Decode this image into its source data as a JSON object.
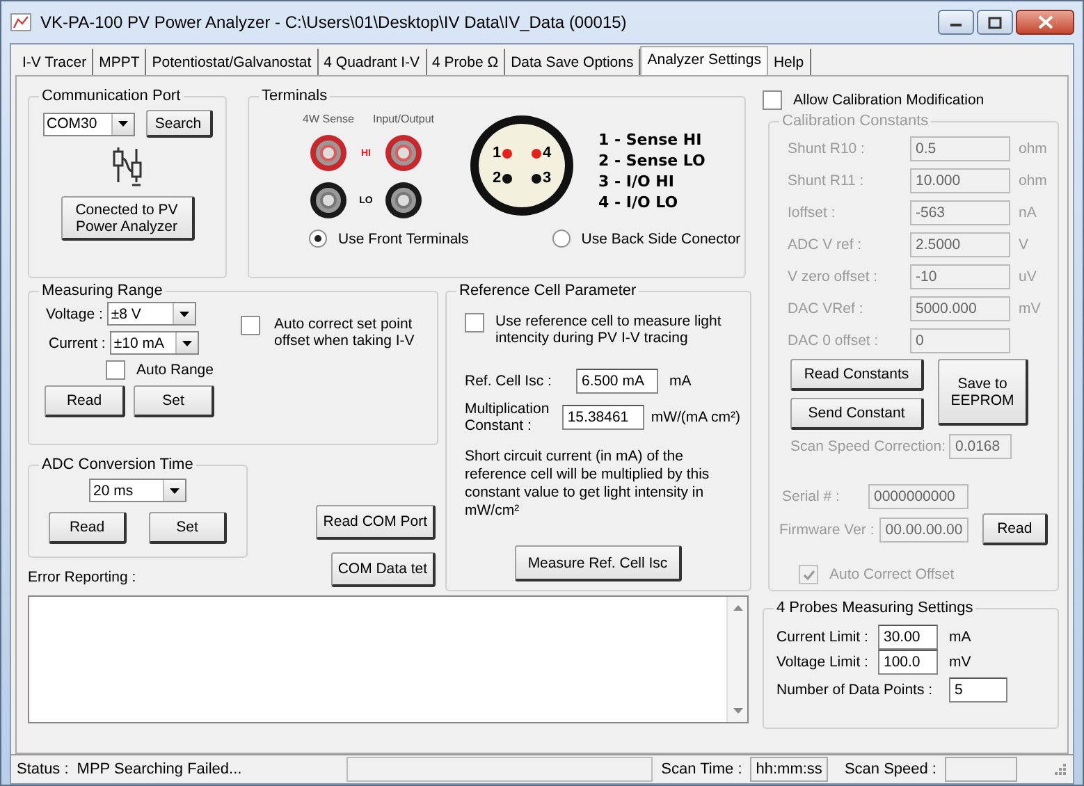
{
  "window": {
    "title": "VK-PA-100 PV Power Analyzer - C:\\Users\\01\\Desktop\\IV Data\\IV_Data (00015)"
  },
  "tabs": [
    {
      "label": "I-V Tracer",
      "selected": false
    },
    {
      "label": "MPPT",
      "selected": false
    },
    {
      "label": "Potentiostat/Galvanostat",
      "selected": false
    },
    {
      "label": "4 Quadrant I-V",
      "selected": false
    },
    {
      "label": "4 Probe Ω",
      "selected": false
    },
    {
      "label": "Data Save Options",
      "selected": false
    },
    {
      "label": "Analyzer Settings",
      "selected": true
    },
    {
      "label": "Help",
      "selected": false
    }
  ],
  "communication_port": {
    "title": "Communication Port",
    "port": "COM30",
    "search_button": "Search",
    "connect_button": "Conected to PV Power Analyzer"
  },
  "terminals": {
    "title": "Terminals",
    "front_labels": [
      "4W Sense",
      "Input/Output"
    ],
    "hi_label": "HI",
    "lo_label": "LO",
    "pins": [
      {
        "label": "1",
        "color": "#e8201c"
      },
      {
        "label": "4",
        "color": "#e8201c"
      },
      {
        "label": "2",
        "color": "#111111"
      },
      {
        "label": "3",
        "color": "#111111"
      }
    ],
    "legend": [
      "1 - Sense HI",
      "2 - Sense LO",
      "3 - I/O HI",
      "4 - I/O LO"
    ],
    "options": [
      {
        "label": "Use Front Terminals",
        "selected": true
      },
      {
        "label": "Use Back Side Conector",
        "selected": false
      }
    ]
  },
  "measuring_range": {
    "title": "Measuring Range",
    "voltage_label": "Voltage :",
    "voltage": "±8 V",
    "current_label": "Current :",
    "current": "±10 mA",
    "auto_range": {
      "label": "Auto Range",
      "checked": false
    },
    "buttons": [
      "Read",
      "Set"
    ],
    "auto_correct": {
      "label": "Auto correct set point offset when taking I-V",
      "checked": false
    }
  },
  "adc_conversion": {
    "title": "ADC Conversion Time",
    "value": "20 ms",
    "buttons": [
      "Read",
      "Set"
    ]
  },
  "com_buttons": [
    "Read COM Port",
    "COM Data tet"
  ],
  "reference_cell": {
    "title": "Reference Cell Parameter",
    "use_reference": {
      "label": "Use reference cell to measure light intencity during PV I-V tracing",
      "checked": false
    },
    "isc_label": "Ref. Cell Isc :",
    "isc": "6.500 mA",
    "isc_unit": "mA",
    "mult_label": "Multiplication Constant :",
    "mult": "15.38461",
    "mult_unit": "mW/(mA cm²)",
    "note": "Short circuit current (in mA) of the reference cell will be multiplied by this constant value to get light intensity in mW/cm²",
    "measure_button": "Measure Ref. Cell Isc"
  },
  "error_reporting": {
    "label": "Error Reporting :"
  },
  "allow_calibration": {
    "label": "Allow Calibration Modification",
    "checked": false
  },
  "calibration": {
    "title": "Calibration Constants",
    "disabled": true,
    "rows": [
      {
        "label": "Shunt R10 :",
        "value": "0.5",
        "unit": "ohm"
      },
      {
        "label": "Shunt R11 :",
        "value": "10.000",
        "unit": "ohm"
      },
      {
        "label": "Ioffset :",
        "value": "-563",
        "unit": "nA"
      },
      {
        "label": "ADC V ref :",
        "value": "2.5000",
        "unit": "V"
      },
      {
        "label": "V zero offset :",
        "value": "-10",
        "unit": "uV"
      },
      {
        "label": "DAC VRef :",
        "value": "5000.000",
        "unit": "mV"
      },
      {
        "label": "DAC 0 offset :",
        "value": "0"
      }
    ],
    "read_button": "Read Constants",
    "send_button": "Send Constant",
    "save_button": "Save to EEPROM",
    "scan_speed_label": "Scan Speed Correction:",
    "scan_speed": "0.0168",
    "serial_label": "Serial # :",
    "serial": "0000000000",
    "firmware_label": "Firmware Ver :",
    "firmware": "00.00.00.00",
    "firmware_read": "Read",
    "auto_correct_offset": {
      "label": "Auto Correct Offset",
      "checked": true
    }
  },
  "probes": {
    "title": "4 Probes Measuring Settings",
    "rows": [
      {
        "label": "Current Limit :",
        "value": "30.00",
        "unit": "mA"
      },
      {
        "label": "Voltage Limit :",
        "value": "100.0",
        "unit": "mV"
      },
      {
        "label": "Number of Data Points :",
        "value": "5"
      }
    ]
  },
  "status_bar": {
    "status_label": "Status :",
    "status": "MPP Searching Failed...",
    "scan_time_label": "Scan Time :",
    "scan_time": "hh:mm:ss",
    "scan_speed_label": "Scan Speed :"
  }
}
